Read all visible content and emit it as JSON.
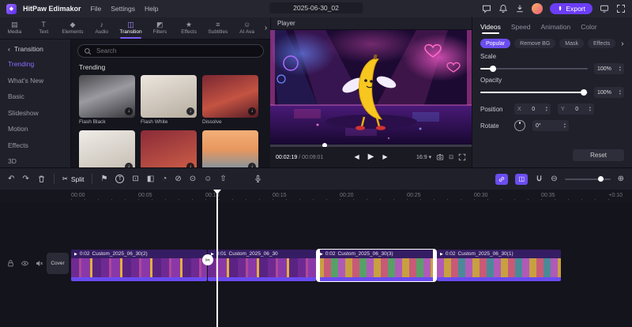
{
  "colors": {
    "accent": "#7c5cf5",
    "export_button": "#6b3df5",
    "selected_clip_outline": "#ffffff"
  },
  "app": {
    "name": "HitPaw Edimakor",
    "menus": [
      "File",
      "Settings",
      "Help"
    ],
    "project_title": "2025-06-30_02",
    "export_label": "Export"
  },
  "icons": {
    "logo": "◆",
    "back": "‹",
    "more": "›",
    "caret": "▾",
    "up": "▴",
    "down": "▾",
    "play": "▶",
    "prev": "◀",
    "next": "▶",
    "undo": "↶",
    "redo": "↷",
    "scissors": "✂",
    "marker": "⚑",
    "text_tool": "T",
    "crop": "⊡",
    "mask": "◧",
    "speed": "◔",
    "chroma": "⊘",
    "snapshot": "⊙",
    "avatar_tool": "☺",
    "upload": "⇧",
    "overlap": "◫",
    "zoom_out": "⊖",
    "zoom_in": "⊕",
    "download": "↓",
    "fit": "⊡"
  },
  "media_tabs": {
    "items": [
      {
        "icon": "▤",
        "label": "Media"
      },
      {
        "icon": "T",
        "label": "Text"
      },
      {
        "icon": "◆",
        "label": "Elements"
      },
      {
        "icon": "♪",
        "label": "Audio"
      },
      {
        "icon": "◫",
        "label": "Transition"
      },
      {
        "icon": "◩",
        "label": "Filters"
      },
      {
        "icon": "★",
        "label": "Effects"
      },
      {
        "icon": "≡",
        "label": "Subtitles"
      },
      {
        "icon": "☺",
        "label": "AI Ava"
      }
    ],
    "more": "›"
  },
  "sidebar": {
    "header": "Transition",
    "items": [
      "Trending",
      "What's New",
      "Basic",
      "Slideshow",
      "Motion",
      "Effects",
      "3D"
    ]
  },
  "library": {
    "search_placeholder": "Search",
    "section": "Trending",
    "cards": [
      {
        "label": "Flash Black"
      },
      {
        "label": "Flash White"
      },
      {
        "label": "Dissolve"
      },
      {
        "label": ""
      },
      {
        "label": ""
      },
      {
        "label": ""
      }
    ]
  },
  "player": {
    "title": "Player",
    "current": "00:02:19",
    "separator": " / ",
    "total": "00:09:01",
    "ratio": "16:9",
    "progress_left": "27%"
  },
  "props": {
    "tabs": [
      "Videos",
      "Speed",
      "Animation",
      "Color"
    ],
    "subtabs": [
      "Popular",
      "Remove BG",
      "Mask",
      "Effects"
    ],
    "scale": {
      "label": "Scale",
      "value": "100%",
      "knob": "12%"
    },
    "opacity": {
      "label": "Opacity",
      "value": "100%",
      "knob": "96%"
    },
    "position": {
      "label": "Position",
      "x_label": "X",
      "x": "0",
      "y_label": "Y",
      "y": "0"
    },
    "rotate": {
      "label": "Rotate",
      "value": "0°"
    },
    "reset": "Reset"
  },
  "timeline": {
    "split": "Split",
    "ruler": [
      "00:00",
      "00:05",
      "00:10",
      "00:15",
      "00:20",
      "00:25",
      "00:30",
      "00:35"
    ],
    "zoom_hint": "+0:10",
    "zoom_knob": "78%",
    "cover": "Cover",
    "clips": [
      {
        "duration": "0:02",
        "name": "Custom_2025_06_30(2)"
      },
      {
        "duration": "0:01",
        "name": "Custom_2025_06_30"
      },
      {
        "duration": "0:02",
        "name": "Custom_2025_06_30(3)"
      },
      {
        "duration": "0:02",
        "name": "Custom_2025_06_30(1)"
      }
    ]
  }
}
